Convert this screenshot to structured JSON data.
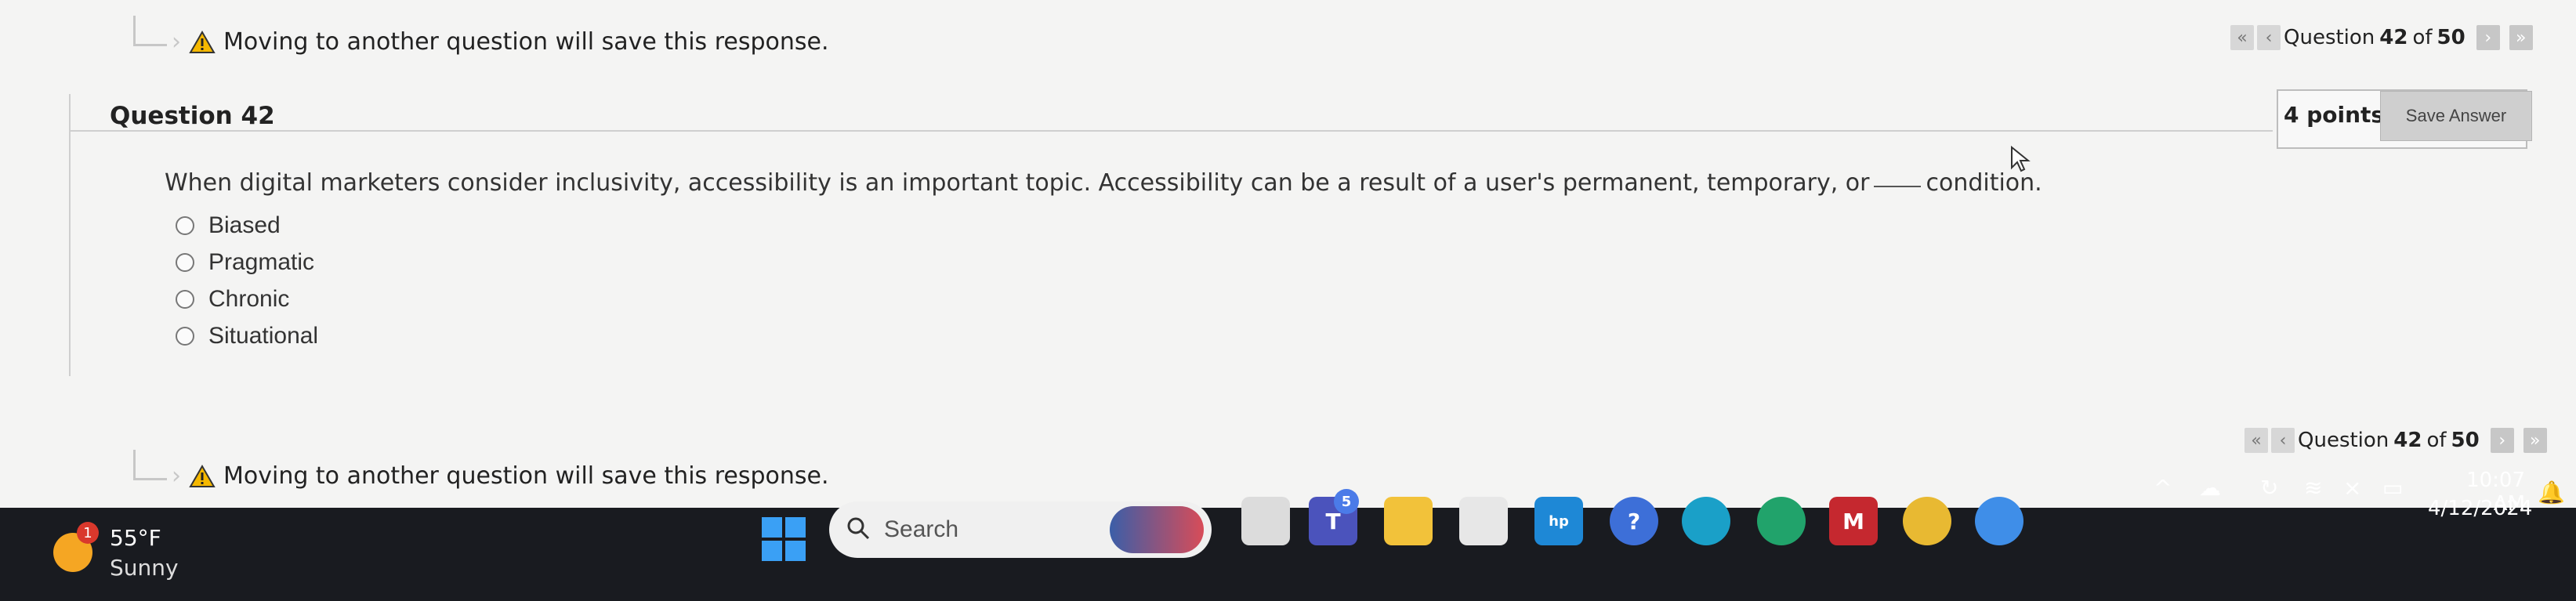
{
  "notice": {
    "text": "Moving to another question will save this response."
  },
  "nav": {
    "prefix": "Question",
    "current": "42",
    "separator": "of",
    "total": "50"
  },
  "question": {
    "heading": "Question 42",
    "points": "4 points",
    "save_label": "Save Answer",
    "text_before": "When digital marketers consider inclusivity, accessibility is an important topic. Accessibility can be a result of a user's permanent, temporary, or",
    "text_after": "condition.",
    "options": [
      "Biased",
      "Pragmatic",
      "Chronic",
      "Situational"
    ]
  },
  "taskbar": {
    "weather": {
      "badge": "1",
      "temp": "55°F",
      "condition": "Sunny"
    },
    "search_placeholder": "Search",
    "teams_badge": "5",
    "clock": {
      "time": "10:07 AM",
      "date": "4/12/2024"
    }
  },
  "icons": {
    "warning": "warning-triangle-icon",
    "first": "«",
    "prev": "‹",
    "next": "›",
    "last": "»"
  },
  "colors": {
    "warning": "#f5b800",
    "taskbar": "#191b20",
    "accent": "#3aa0f5"
  }
}
